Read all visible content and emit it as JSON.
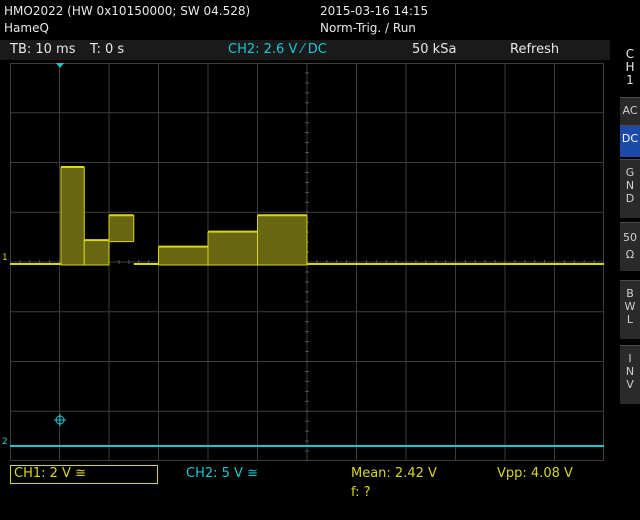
{
  "header": {
    "model_line": "HMO2022 (HW 0x10150000; SW 04.528)",
    "owner": "HameQ",
    "datetime": "2015-03-16 14:15",
    "trigger_mode": "Norm-Trig. / Run"
  },
  "topbar": {
    "timebase": "TB: 10 ms",
    "trigger_time": "T: 0 s",
    "trigger_source": "CH2: 2.6 V ⁄ DC",
    "sample_rate": "50 kSa",
    "mode": "Refresh"
  },
  "bottombar": {
    "ch1": "CH1: 2 V ≅",
    "ch2": "CH2: 5 V ≅",
    "mean": "Mean: 2.42 V",
    "vpp": "Vpp: 4.08 V",
    "freq": "f: ?"
  },
  "side_panel": {
    "channel_label": [
      "C",
      "H",
      "1"
    ],
    "buttons": [
      {
        "id": "ac",
        "lines": [
          "AC"
        ],
        "active": false
      },
      {
        "id": "dc",
        "lines": [
          "DC"
        ],
        "active": true
      },
      {
        "id": "gnd",
        "lines": [
          "G",
          "N",
          "D"
        ],
        "active": false
      },
      {
        "id": "ohm",
        "lines": [
          "50",
          "Ω"
        ],
        "active": false
      },
      {
        "id": "bwl",
        "lines": [
          "B",
          "W",
          "L"
        ],
        "active": false
      },
      {
        "id": "inv",
        "lines": [
          "I",
          "N",
          "V"
        ],
        "active": false
      }
    ]
  },
  "markers": {
    "ch1_marker": "1",
    "ch2_marker": "2"
  },
  "colors": {
    "ch1": "#d8d61b",
    "ch2": "#19c6d6",
    "grid": "#3c3c3c",
    "active_button": "#1c4aa8"
  },
  "chart_data": {
    "type": "line",
    "grid": true,
    "divisions": {
      "x": 12,
      "y": 8
    },
    "series": [
      {
        "name": "CH1",
        "segments": [
          {
            "t_div": [
              0.0,
              1.03
            ],
            "y_div": [
              0.0,
              0.0
            ]
          },
          {
            "t_div": [
              1.03,
              1.5
            ],
            "y_div": [
              -0.02,
              1.95
            ]
          },
          {
            "t_div": [
              1.5,
              2.0
            ],
            "y_div": [
              -0.02,
              0.48
            ]
          },
          {
            "t_div": [
              2.0,
              2.5
            ],
            "y_div": [
              0.45,
              0.98
            ]
          },
          {
            "t_div": [
              2.5,
              3.0
            ],
            "y_div": [
              0.0,
              0.0
            ]
          },
          {
            "t_div": [
              3.0,
              4.0
            ],
            "y_div": [
              -0.02,
              0.35
            ]
          },
          {
            "t_div": [
              4.0,
              5.0
            ],
            "y_div": [
              -0.02,
              0.65
            ]
          },
          {
            "t_div": [
              5.0,
              6.0
            ],
            "y_div": [
              -0.02,
              0.98
            ]
          },
          {
            "t_div": [
              6.0,
              12.0
            ],
            "y_div": [
              0.0,
              0.0
            ]
          }
        ]
      },
      {
        "name": "CH2",
        "segments": [
          {
            "t_div": [
              0.0,
              12.0
            ],
            "y_div": [
              0.0,
              0.0
            ]
          }
        ]
      }
    ]
  }
}
